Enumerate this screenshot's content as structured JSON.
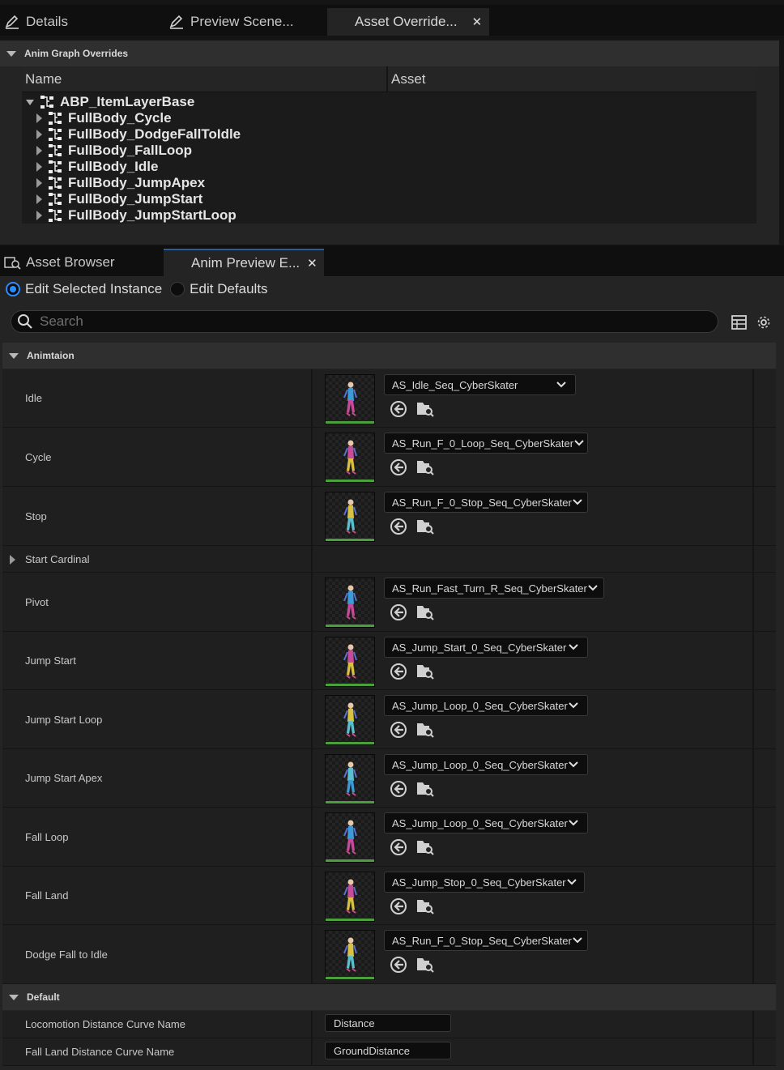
{
  "top_tabs": [
    {
      "label": "Details",
      "icon": "pencil-icon"
    },
    {
      "label": "Preview Scene...",
      "icon": "pencil-icon"
    },
    {
      "label": "Asset Override...",
      "icon": "",
      "active": true
    }
  ],
  "overrides": {
    "section_title": "Anim Graph Overrides",
    "col_name": "Name",
    "col_asset": "Asset",
    "root": "ABP_ItemLayerBase",
    "children": [
      "FullBody_Cycle",
      "FullBody_DodgeFallToIdle",
      "FullBody_FallLoop",
      "FullBody_Idle",
      "FullBody_JumpApex",
      "FullBody_JumpStart",
      "FullBody_JumpStartLoop"
    ]
  },
  "bottom_tabs": [
    {
      "label": "Asset Browser",
      "icon": "asset-browser-icon"
    },
    {
      "label": "Anim Preview E...",
      "active": true
    }
  ],
  "edit_mode": {
    "selected": "Edit Selected Instance",
    "other": "Edit Defaults"
  },
  "search": {
    "placeholder": "Search"
  },
  "animation": {
    "section_title": "Animtaion",
    "rows": [
      {
        "label": "Idle",
        "asset": "AS_Idle_Seq_CyberSkater"
      },
      {
        "label": "Cycle",
        "asset": "AS_Run_F_0_Loop_Seq_CyberSkater"
      },
      {
        "label": "Stop",
        "asset": "AS_Run_F_0_Stop_Seq_CyberSkater"
      },
      {
        "label": "Start Cardinal",
        "asset": ""
      },
      {
        "label": "Pivot",
        "asset": "AS_Run_Fast_Turn_R_Seq_CyberSkater"
      },
      {
        "label": "Jump Start",
        "asset": "AS_Jump_Start_0_Seq_CyberSkater"
      },
      {
        "label": "Jump Start Loop",
        "asset": "AS_Jump_Loop_0_Seq_CyberSkater"
      },
      {
        "label": "Jump Start Apex",
        "asset": "AS_Jump_Loop_0_Seq_CyberSkater"
      },
      {
        "label": "Fall Loop",
        "asset": "AS_Jump_Loop_0_Seq_CyberSkater"
      },
      {
        "label": "Fall Land",
        "asset": "AS_Jump_Stop_0_Seq_CyberSkater"
      },
      {
        "label": "Dodge Fall to Idle",
        "asset": "AS_Run_F_0_Stop_Seq_CyberSkater"
      }
    ]
  },
  "defaults": {
    "section_title": "Default",
    "rows": [
      {
        "label": "Locomotion Distance Curve Name",
        "value": "Distance"
      },
      {
        "label": "Fall Land Distance Curve Name",
        "value": "GroundDistance"
      }
    ]
  },
  "colors": {
    "accent": "#2a8cff",
    "thumb_bar": "#4aa03a",
    "panel": "#1f1f1f"
  }
}
